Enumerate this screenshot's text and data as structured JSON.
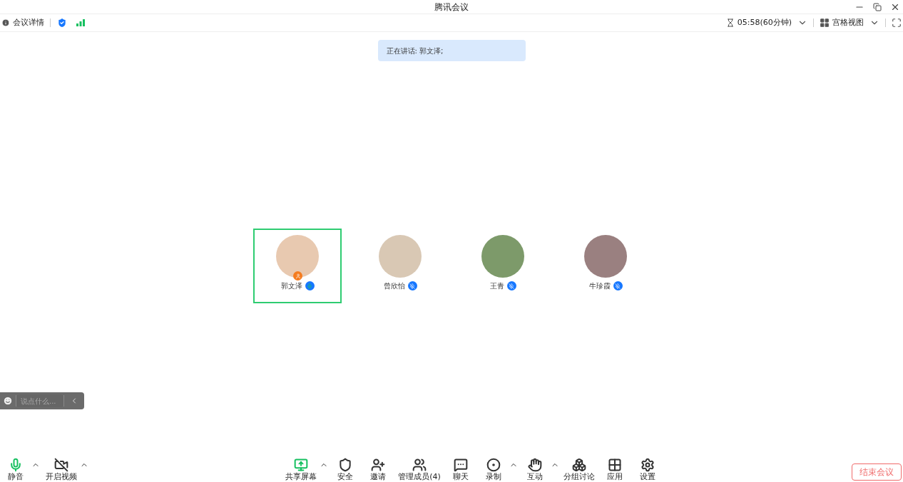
{
  "window": {
    "title": "腾讯会议"
  },
  "top_bar": {
    "meeting_info": "会议详情",
    "timer": "05:58(60分钟)",
    "view": "宫格视图"
  },
  "speaking_banner": "正在讲话: 郭文泽;",
  "participants": [
    {
      "name": "郭文泽",
      "speaking": true,
      "muted": false,
      "host": true
    },
    {
      "name": "曾欣怡",
      "speaking": false,
      "muted": true,
      "host": false
    },
    {
      "name": "王青",
      "speaking": false,
      "muted": true,
      "host": false
    },
    {
      "name": "牛珍霞",
      "speaking": false,
      "muted": true,
      "host": false
    }
  ],
  "chat_input": {
    "placeholder": "说点什么..."
  },
  "left_controls": [
    {
      "kind": "mic",
      "label": "静音",
      "menu": true
    },
    {
      "kind": "video",
      "label": "开启视频",
      "menu": true
    }
  ],
  "center_controls": [
    {
      "kind": "share",
      "label": "共享屏幕",
      "menu": true
    },
    {
      "kind": "security",
      "label": "安全",
      "menu": false
    },
    {
      "kind": "invite",
      "label": "邀请",
      "menu": false
    },
    {
      "kind": "members",
      "label": "管理成员(4)",
      "menu": false
    },
    {
      "kind": "chat",
      "label": "聊天",
      "menu": false
    },
    {
      "kind": "record",
      "label": "录制",
      "menu": true
    },
    {
      "kind": "interact",
      "label": "互动",
      "menu": true
    },
    {
      "kind": "breakout",
      "label": "分组讨论",
      "menu": false
    },
    {
      "kind": "apps",
      "label": "应用",
      "menu": false
    },
    {
      "kind": "settings",
      "label": "设置",
      "menu": false
    }
  ],
  "end_button": "结束会议"
}
